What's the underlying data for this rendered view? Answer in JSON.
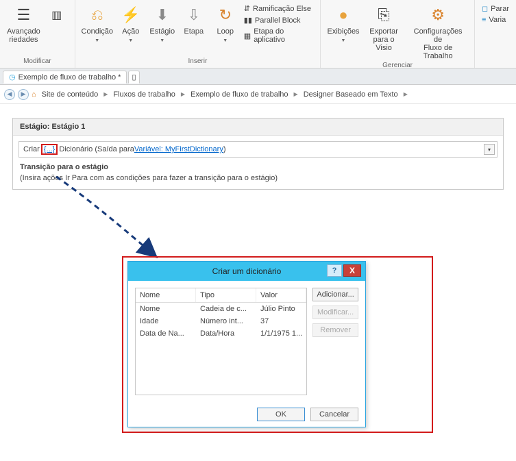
{
  "ribbon": {
    "group_modificar": {
      "label": "Modificar",
      "avancado": "Avançado",
      "riedades": "riedades"
    },
    "group_inserir": {
      "label": "Inserir",
      "condicao": "Condição",
      "acao": "Ação",
      "estagio": "Estágio",
      "etapa": "Etapa",
      "loop": "Loop",
      "ramificacao": "Ramificação Else",
      "parallel": "Parallel Block",
      "etapa_app": "Etapa do aplicativo"
    },
    "group_gerenciar": {
      "label": "Gerenciar",
      "exibicoes": "Exibições",
      "exportar": "Exportar",
      "exportar2": "para o Visio",
      "config": "Configurações de",
      "config2": "Fluxo de Trabalho"
    },
    "right": {
      "parar": "Parar",
      "varia": "Varia"
    }
  },
  "tabs": {
    "active": "Exemplo de fluxo de trabalho *"
  },
  "breadcrumb": {
    "items": [
      "Site de conteúdo",
      "Fluxos de trabalho",
      "Exemplo de fluxo de trabalho",
      "Designer Baseado em Texto"
    ]
  },
  "stage": {
    "header": "Estágio: Estágio 1",
    "action_pre": "Criar ",
    "action_token": "{...}",
    "action_mid": " Dicionário (Saída para ",
    "action_var": "Variável: MyFirstDictionary",
    "action_post": ")",
    "trans_head": "Transição para o estágio",
    "trans_body": "(Insira ações Ir Para com as condições para fazer a transição para o estágio)"
  },
  "dialog": {
    "title": "Criar um dicionário",
    "help": "?",
    "close": "X",
    "cols": {
      "name": "Nome",
      "type": "Tipo",
      "value": "Valor"
    },
    "rows": [
      {
        "name": "Nome",
        "type": "Cadeia de c...",
        "value": "Júlio Pinto"
      },
      {
        "name": "Idade",
        "type": "Número int...",
        "value": "37"
      },
      {
        "name": "Data de Na...",
        "type": "Data/Hora",
        "value": "1/1/1975 1..."
      }
    ],
    "btn_add": "Adicionar...",
    "btn_mod": "Modificar...",
    "btn_rem": "Remover",
    "btn_ok": "OK",
    "btn_cancel": "Cancelar"
  }
}
